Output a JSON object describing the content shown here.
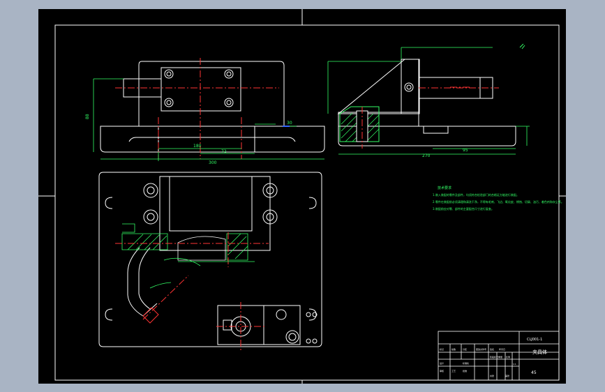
{
  "drawing": {
    "background_color": "#000000",
    "viewport_color": "#a9b4c4",
    "line_color": "#ffffff",
    "center_line_color": "#ff3333",
    "dimension_color": "#33ff66",
    "hatch_color": "#33ff66",
    "note_color": "#33ff66",
    "accent_yellow": "#ffff00",
    "accent_blue": "#3366ff"
  },
  "front_view": {
    "dim_left_vertical": "88",
    "dim_bottom_total": "300",
    "dim_bottom_a": "180",
    "dim_bottom_b": "72",
    "dim_right_vertical": "30"
  },
  "side_view": {
    "dim_bottom_total": "270",
    "dim_bottom_a": "95"
  },
  "technical_notes": {
    "title": "技术要求",
    "lines": [
      "1.装入装配的零件及部件，均须符合检验部门的合格证方能进行装配。",
      "2.零件在装配前必须清理和清洗干净，不得有毛刺、飞边、氧化皮、锈蚀、切屑、油污、着色剂和灰尘等。",
      "3.装配前应对零、部件的主要配合尺寸进行复查。"
    ]
  },
  "title_block": {
    "drawing_number": "CLJ001-1",
    "part_name": "夹具体",
    "material": "45",
    "cells": [
      "标记",
      "处数",
      "分区",
      "更改文件号",
      "签名",
      "年月日",
      "设计",
      "标准化",
      "审核",
      "工艺",
      "批准",
      "阶段标记",
      "重量",
      "比例",
      "共张",
      "第张",
      "1:1"
    ]
  }
}
